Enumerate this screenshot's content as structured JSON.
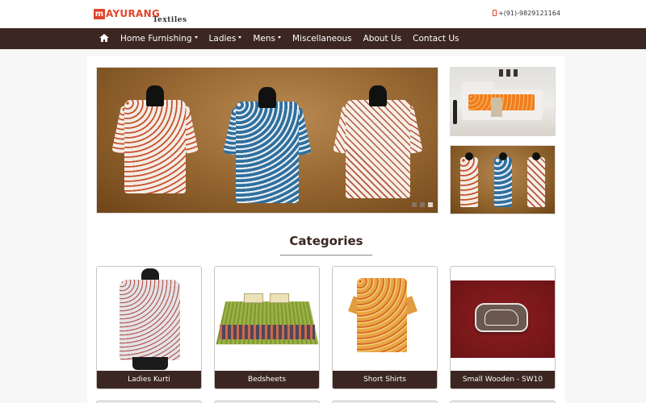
{
  "header": {
    "logo": {
      "initial": "m",
      "brand": "AYURANG",
      "sub": "Textiles"
    },
    "phone": "+(91)-9829121164",
    "phone_icon": "mobile-phone-icon"
  },
  "nav": {
    "home_icon": "home-icon",
    "items": [
      {
        "label": "Home Furnishing",
        "dropdown": true
      },
      {
        "label": "Ladies",
        "dropdown": true
      },
      {
        "label": "Mens",
        "dropdown": true
      },
      {
        "label": "Miscellaneous",
        "dropdown": false
      },
      {
        "label": "About Us",
        "dropdown": false
      },
      {
        "label": "Contact Us",
        "dropdown": false
      }
    ]
  },
  "slider": {
    "slide_count": 3,
    "active_slide": 3,
    "description": "Three block-printed kurtis on mannequins"
  },
  "side_images": [
    {
      "description": "Bedroom with orange printed bedsheet"
    },
    {
      "description": "Three kurtis on mannequins"
    }
  ],
  "categories": {
    "title": "Categories",
    "items": [
      {
        "label": "Ladies Kurti"
      },
      {
        "label": "Bedsheets"
      },
      {
        "label": "Short Shirts"
      },
      {
        "label": "Small Wooden - SW10"
      }
    ]
  },
  "colors": {
    "brand_red": "#e0462a",
    "nav_brown": "#3b2621",
    "page_bg": "#f7f7f7"
  }
}
